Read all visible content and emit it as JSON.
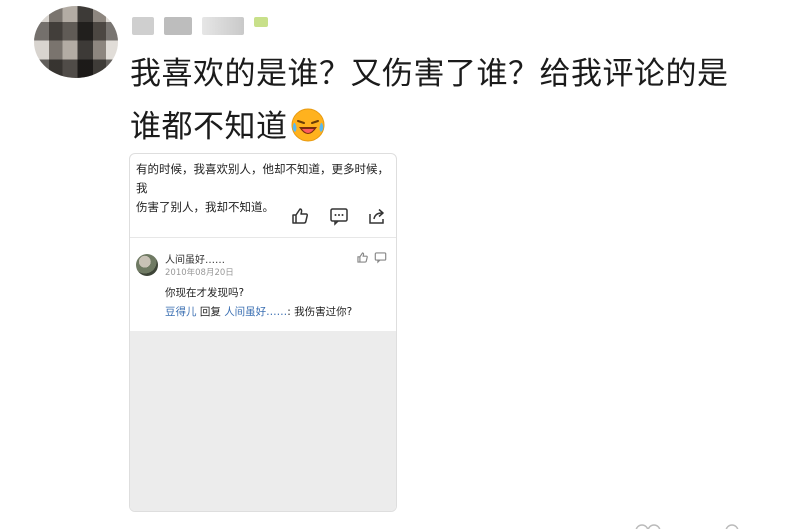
{
  "post": {
    "text_line1": "我喜欢的是谁？又伤害了谁？给我评论的是",
    "text_line2": "谁都不知道",
    "emoji": "laughing-crying-icon"
  },
  "embed": {
    "quote_line1": "有的时候，我喜欢别人，他却不知道，更多时候，我",
    "quote_line2": "伤害了别人，我却不知道。",
    "actions": [
      "like-icon",
      "comment-icon",
      "share-icon"
    ],
    "comment": {
      "author": "人间虽好……",
      "date": "2010年08月20日",
      "text": "你现在才发现吗?",
      "reply_user": "豆得儿",
      "reply_word": " 回复 ",
      "reply_target": "人间虽好……",
      "reply_text": ": 我伤害过你?"
    }
  },
  "colors": {
    "link": "#3b6fb2",
    "emoji_yellow": "#ffb21e"
  }
}
